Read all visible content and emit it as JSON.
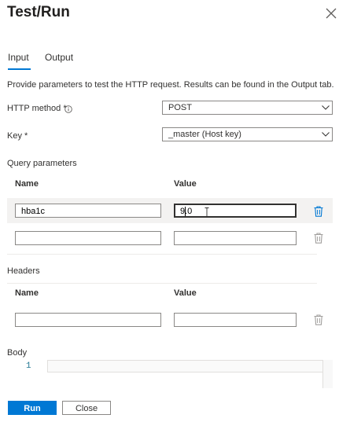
{
  "header": {
    "title": "Test/Run"
  },
  "tabs": [
    {
      "label": "Input",
      "active": true
    },
    {
      "label": "Output",
      "active": false
    }
  ],
  "description": "Provide parameters to test the HTTP request. Results can be found in the Output tab.",
  "http_method": {
    "label": "HTTP method *",
    "value": "POST"
  },
  "key": {
    "label": "Key *",
    "value": "_master (Host key)"
  },
  "query_parameters": {
    "title": "Query parameters",
    "columns": {
      "name": "Name",
      "value": "Value"
    },
    "rows": [
      {
        "name": "hba1c",
        "value": "9.0"
      },
      {
        "name": "",
        "value": ""
      }
    ]
  },
  "headers": {
    "title": "Headers",
    "columns": {
      "name": "Name",
      "value": "Value"
    },
    "rows": [
      {
        "name": "",
        "value": ""
      }
    ]
  },
  "body": {
    "title": "Body",
    "line_number": "1",
    "content": ""
  },
  "footer": {
    "run_label": "Run",
    "close_label": "Close"
  },
  "colors": {
    "accent": "#0078d4",
    "active_row_delete": "#0078d4",
    "inactive_delete": "#a19f9d",
    "row_highlight": "#f3f2f1"
  }
}
